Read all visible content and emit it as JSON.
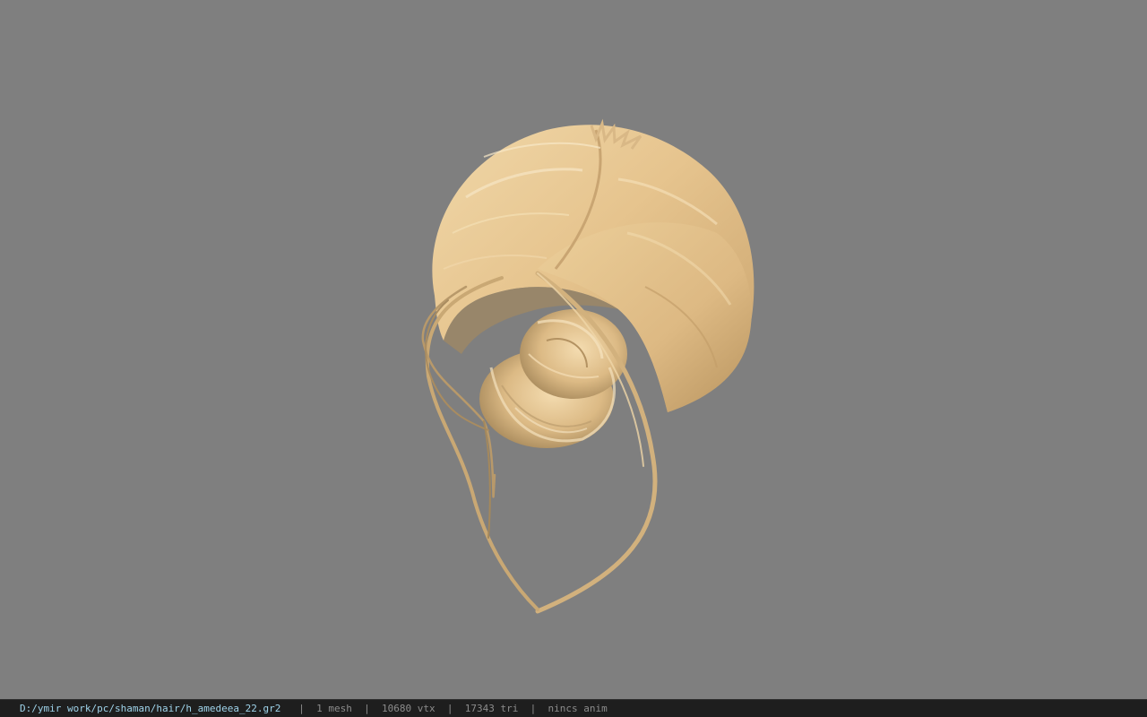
{
  "viewport": {
    "background_color": "#7f7f7f",
    "model": {
      "name": "hair-mesh",
      "hair_color": "#e2bf8b",
      "shadow_color": "#a78859"
    }
  },
  "statusbar": {
    "file_path": "D:/ymir work/pc/shaman/hair/h_amedeea_22.gr2",
    "separator": "|",
    "mesh_count": "1 mesh",
    "vertex_count": "10680 vtx",
    "triangle_count": "17343 tri",
    "anim_status": "nincs anim",
    "path_color": "#9fd3ea",
    "text_color": "#8c8c8c"
  }
}
